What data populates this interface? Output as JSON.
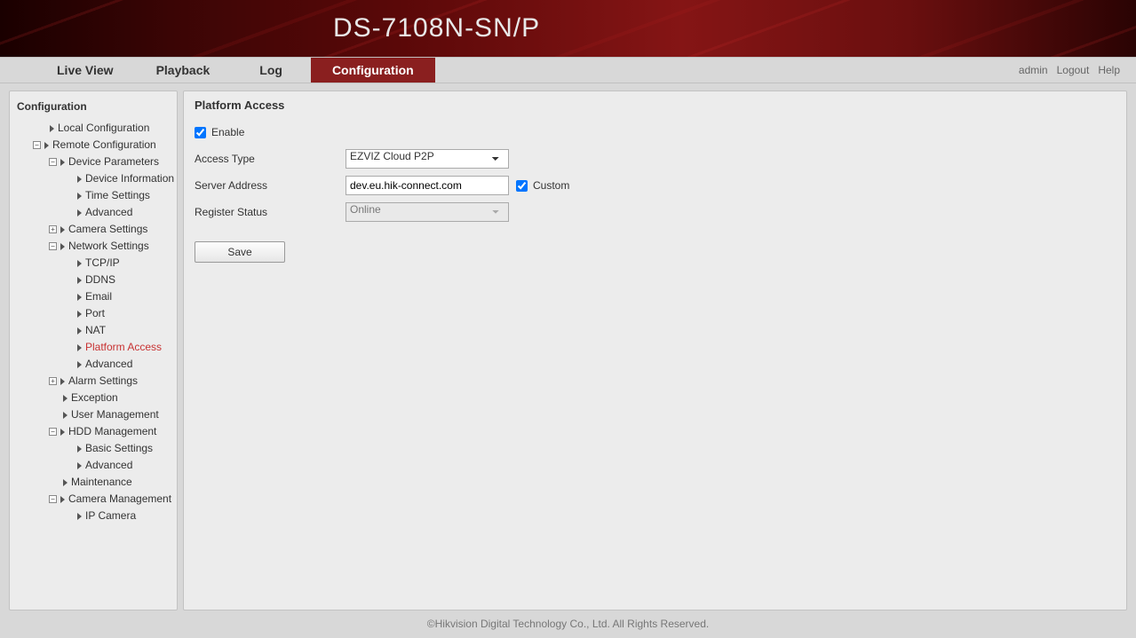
{
  "header": {
    "title": "DS-7108N-SN/P"
  },
  "nav": {
    "tabs": {
      "live": "Live View",
      "playback": "Playback",
      "log": "Log",
      "config": "Configuration"
    },
    "right": {
      "user": "admin",
      "logout": "Logout",
      "help": "Help"
    }
  },
  "sidebar": {
    "title": "Configuration",
    "local": "Local Configuration",
    "remote": "Remote Configuration",
    "devparams": "Device Parameters",
    "devinfo": "Device Information",
    "timeset": "Time Settings",
    "advanced1": "Advanced",
    "camset": "Camera Settings",
    "netset": "Network Settings",
    "tcpip": "TCP/IP",
    "ddns": "DDNS",
    "email": "Email",
    "port": "Port",
    "nat": "NAT",
    "platform": "Platform Access",
    "advanced2": "Advanced",
    "alarm": "Alarm Settings",
    "exception": "Exception",
    "usermgmt": "User Management",
    "hdd": "HDD Management",
    "basicset": "Basic Settings",
    "advanced3": "Advanced",
    "maint": "Maintenance",
    "cammgmt": "Camera Management",
    "ipcam": "IP Camera"
  },
  "content": {
    "title": "Platform Access",
    "enable": "Enable",
    "accessType": "Access Type",
    "accessTypeValue": "EZVIZ Cloud P2P",
    "serverAddr": "Server Address",
    "serverAddrValue": "dev.eu.hik-connect.com",
    "custom": "Custom",
    "regStatus": "Register Status",
    "regStatusValue": "Online",
    "save": "Save"
  },
  "footer": "©Hikvision Digital Technology Co., Ltd. All Rights Reserved."
}
